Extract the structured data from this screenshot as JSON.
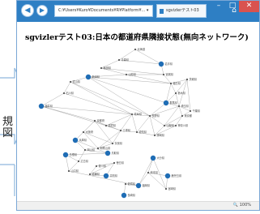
{
  "callout": {
    "line1": "規",
    "line2": "図"
  },
  "browser": {
    "address": "C:¥Users¥Kuro¥Documents¥R¥Platform¥... ▾",
    "tab_title": "sgvizlerテスト03",
    "zoom": "100%"
  },
  "page": {
    "heading": "sgvizlerテスト03:日本の都道府県隣接状態(無向ネットワーク)"
  },
  "colors": {
    "titlebar": "#2e7fc4",
    "node_fill": "#1f6db5",
    "edge": "#9a9a9a",
    "close_button": "#d9534f"
  },
  "graph": {
    "nodes": [
      {
        "label": "北海道",
        "big": false
      },
      {
        "label": "青森県",
        "big": false
      },
      {
        "label": "岩手県",
        "big": true
      },
      {
        "label": "秋田県",
        "big": false
      },
      {
        "label": "宮城県",
        "big": false
      },
      {
        "label": "山形県",
        "big": false
      },
      {
        "label": "福島県",
        "big": false
      },
      {
        "label": "茨城県",
        "big": false
      },
      {
        "label": "栃木県",
        "big": false
      },
      {
        "label": "群馬県",
        "big": true
      },
      {
        "label": "埼玉県",
        "big": false
      },
      {
        "label": "千葉県",
        "big": false
      },
      {
        "label": "東京都",
        "big": false
      },
      {
        "label": "神奈川県",
        "big": false
      },
      {
        "label": "新潟県",
        "big": true
      },
      {
        "label": "富山県",
        "big": false
      },
      {
        "label": "石川県",
        "big": false
      },
      {
        "label": "福井県",
        "big": true
      },
      {
        "label": "山梨県",
        "big": false
      },
      {
        "label": "長野県",
        "big": false
      },
      {
        "label": "岐阜県",
        "big": false
      },
      {
        "label": "静岡県",
        "big": false
      },
      {
        "label": "愛知県",
        "big": false
      },
      {
        "label": "三重県",
        "big": false
      },
      {
        "label": "滋賀県",
        "big": false
      },
      {
        "label": "京都府",
        "big": false
      },
      {
        "label": "大阪府",
        "big": false
      },
      {
        "label": "兵庫県",
        "big": true
      },
      {
        "label": "奈良県",
        "big": false
      },
      {
        "label": "和歌山県",
        "big": false
      },
      {
        "label": "鳥取県",
        "big": true
      },
      {
        "label": "島根県",
        "big": true
      },
      {
        "label": "岡山県",
        "big": false
      },
      {
        "label": "広島県",
        "big": false
      },
      {
        "label": "山口県",
        "big": false
      },
      {
        "label": "徳島県",
        "big": false
      },
      {
        "label": "香川県",
        "big": false
      },
      {
        "label": "愛媛県",
        "big": false
      },
      {
        "label": "高知県",
        "big": true
      },
      {
        "label": "福岡県",
        "big": true
      },
      {
        "label": "佐賀県",
        "big": false
      },
      {
        "label": "長崎県",
        "big": true
      },
      {
        "label": "熊本県",
        "big": false
      },
      {
        "label": "大分県",
        "big": true
      },
      {
        "label": "宮崎県",
        "big": false
      },
      {
        "label": "鹿児島県",
        "big": true
      }
    ],
    "edges": [
      [
        0,
        1
      ],
      [
        0,
        2
      ],
      [
        1,
        2
      ],
      [
        1,
        3
      ],
      [
        2,
        4
      ],
      [
        3,
        4
      ],
      [
        3,
        5
      ],
      [
        4,
        5
      ],
      [
        4,
        6
      ],
      [
        5,
        6
      ],
      [
        5,
        14
      ],
      [
        6,
        7
      ],
      [
        6,
        8
      ],
      [
        6,
        9
      ],
      [
        6,
        14
      ],
      [
        7,
        8
      ],
      [
        7,
        10
      ],
      [
        7,
        11
      ],
      [
        8,
        9
      ],
      [
        8,
        10
      ],
      [
        9,
        10
      ],
      [
        9,
        14
      ],
      [
        9,
        19
      ],
      [
        10,
        11
      ],
      [
        10,
        12
      ],
      [
        10,
        18
      ],
      [
        10,
        19
      ],
      [
        11,
        12
      ],
      [
        12,
        13
      ],
      [
        12,
        18
      ],
      [
        13,
        18
      ],
      [
        13,
        21
      ],
      [
        14,
        15
      ],
      [
        14,
        19
      ],
      [
        15,
        16
      ],
      [
        15,
        19
      ],
      [
        15,
        20
      ],
      [
        16,
        17
      ],
      [
        16,
        20
      ],
      [
        17,
        20
      ],
      [
        17,
        24
      ],
      [
        17,
        25
      ],
      [
        18,
        19
      ],
      [
        18,
        21
      ],
      [
        19,
        20
      ],
      [
        19,
        21
      ],
      [
        19,
        22
      ],
      [
        20,
        22
      ],
      [
        20,
        23
      ],
      [
        20,
        24
      ],
      [
        21,
        22
      ],
      [
        22,
        23
      ],
      [
        23,
        24
      ],
      [
        23,
        25
      ],
      [
        23,
        28
      ],
      [
        23,
        29
      ],
      [
        24,
        25
      ],
      [
        25,
        26
      ],
      [
        25,
        27
      ],
      [
        25,
        28
      ],
      [
        26,
        27
      ],
      [
        26,
        28
      ],
      [
        26,
        29
      ],
      [
        27,
        30
      ],
      [
        27,
        32
      ],
      [
        28,
        29
      ],
      [
        30,
        31
      ],
      [
        30,
        32
      ],
      [
        31,
        33
      ],
      [
        31,
        34
      ],
      [
        32,
        33
      ],
      [
        33,
        34
      ],
      [
        34,
        39
      ],
      [
        35,
        36
      ],
      [
        35,
        37
      ],
      [
        35,
        38
      ],
      [
        36,
        37
      ],
      [
        37,
        38
      ],
      [
        39,
        40
      ],
      [
        39,
        43
      ],
      [
        39,
        42
      ],
      [
        40,
        41
      ],
      [
        42,
        43
      ],
      [
        42,
        44
      ],
      [
        42,
        45
      ],
      [
        43,
        44
      ],
      [
        44,
        45
      ]
    ]
  }
}
